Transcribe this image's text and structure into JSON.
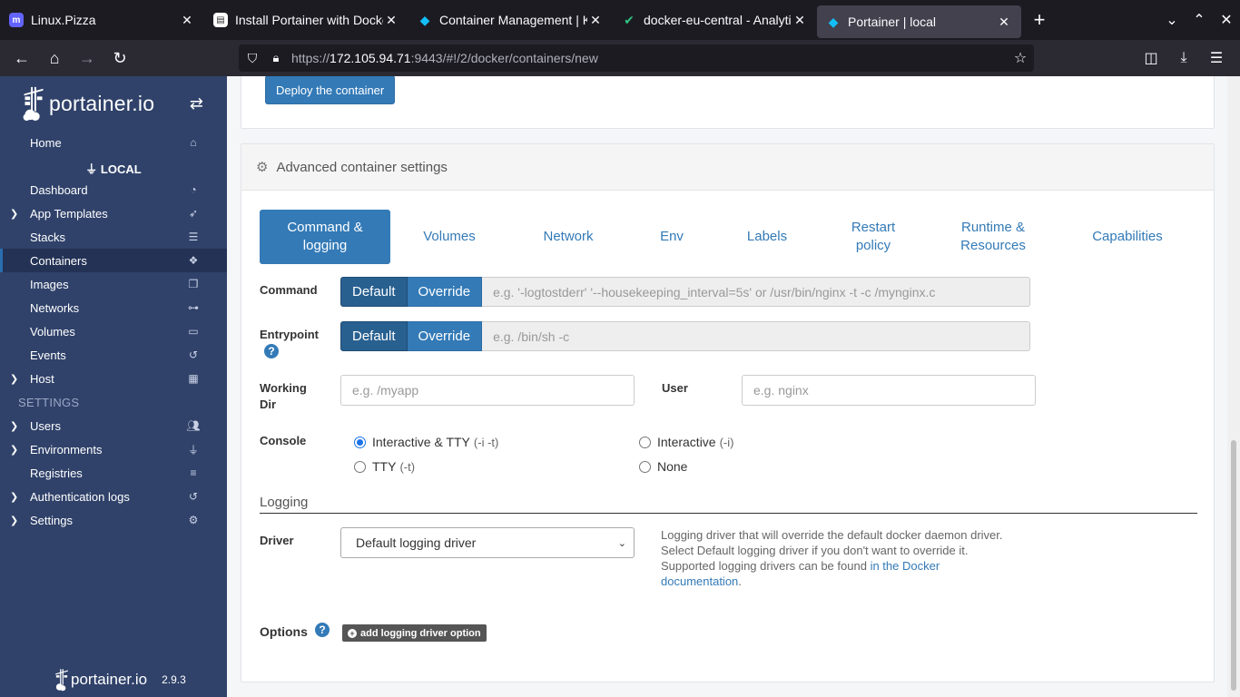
{
  "browser": {
    "tabs": [
      {
        "title": "Linux.Pizza",
        "favicon": "mastodon-icon",
        "favicon_color": "#6364ff"
      },
      {
        "title": "Install Portainer with Docke",
        "favicon": "page-icon",
        "favicon_color": "#ffffff"
      },
      {
        "title": "Container Management | K",
        "favicon": "portainer-icon",
        "favicon_color": "#13bef9"
      },
      {
        "title": "docker-eu-central - Analytic",
        "favicon": "analytics-icon",
        "favicon_color": "#2ec27e"
      },
      {
        "title": "Portainer | local",
        "favicon": "portainer-icon",
        "favicon_color": "#13bef9"
      }
    ],
    "url_prefix": "https://",
    "url_host": "172.105.94.71",
    "url_rest": ":9443/#!/2/docker/containers/new"
  },
  "sidebar": {
    "brand": "portainer.io",
    "home": "Home",
    "endpoint": "LOCAL",
    "items": [
      {
        "label": "Dashboard",
        "icon": "tachometer-icon",
        "expandable": false
      },
      {
        "label": "App Templates",
        "icon": "rocket-icon",
        "expandable": true
      },
      {
        "label": "Stacks",
        "icon": "th-list-icon",
        "expandable": false
      },
      {
        "label": "Containers",
        "icon": "cubes-icon",
        "expandable": false,
        "active": true
      },
      {
        "label": "Images",
        "icon": "clone-icon",
        "expandable": false
      },
      {
        "label": "Networks",
        "icon": "sitemap-icon",
        "expandable": false
      },
      {
        "label": "Volumes",
        "icon": "hdd-icon",
        "expandable": false
      },
      {
        "label": "Events",
        "icon": "history-icon",
        "expandable": false
      },
      {
        "label": "Host",
        "icon": "th-icon",
        "expandable": true
      }
    ],
    "settings_label": "SETTINGS",
    "settings_items": [
      {
        "label": "Users",
        "icon": "users-icon",
        "expandable": true
      },
      {
        "label": "Environments",
        "icon": "plug-icon",
        "expandable": true
      },
      {
        "label": "Registries",
        "icon": "database-icon",
        "expandable": false
      },
      {
        "label": "Authentication logs",
        "icon": "history-icon",
        "expandable": true
      },
      {
        "label": "Settings",
        "icon": "cogs-icon",
        "expandable": true
      }
    ],
    "footer_brand": "portainer.io",
    "version": "2.9.3"
  },
  "main": {
    "deploy_label": "Deploy the container",
    "advanced_title": "Advanced container settings",
    "tabs": [
      {
        "label": "Command & logging",
        "active": true
      },
      {
        "label": "Volumes"
      },
      {
        "label": "Network"
      },
      {
        "label": "Env"
      },
      {
        "label": "Labels"
      },
      {
        "label": "Restart policy"
      },
      {
        "label": "Runtime & Resources"
      },
      {
        "label": "Capabilities"
      }
    ],
    "command": {
      "label": "Command",
      "default": "Default",
      "override": "Override",
      "placeholder": "e.g. '-logtostderr' '--housekeeping_interval=5s' or /usr/bin/nginx -t -c /mynginx.c"
    },
    "entrypoint": {
      "label": "Entrypoint",
      "default": "Default",
      "override": "Override",
      "placeholder": "e.g. /bin/sh -c"
    },
    "working_dir": {
      "label": "Working Dir",
      "placeholder": "e.g. /myapp"
    },
    "user": {
      "label": "User",
      "placeholder": "e.g. nginx"
    },
    "console": {
      "label": "Console",
      "options": [
        {
          "label": "Interactive & TTY",
          "flag": "(-i -t)",
          "checked": true
        },
        {
          "label": "Interactive",
          "flag": "(-i)",
          "checked": false
        },
        {
          "label": "TTY",
          "flag": "(-t)",
          "checked": false
        },
        {
          "label": "None",
          "flag": "",
          "checked": false
        }
      ]
    },
    "logging": {
      "section_title": "Logging",
      "driver_label": "Driver",
      "driver_value": "Default logging driver",
      "help_line1": "Logging driver that will override the default docker daemon driver.",
      "help_line2": "Select Default logging driver if you don't want to override it.",
      "help_line3": "Supported logging drivers can be found",
      "help_link1": "in the Docker",
      "help_link2": "documentation",
      "help_end": ".",
      "options_label": "Options",
      "add_option": "add logging driver option"
    }
  },
  "colors": {
    "sidebar_bg": "#30426a",
    "accent": "#337ab7"
  }
}
